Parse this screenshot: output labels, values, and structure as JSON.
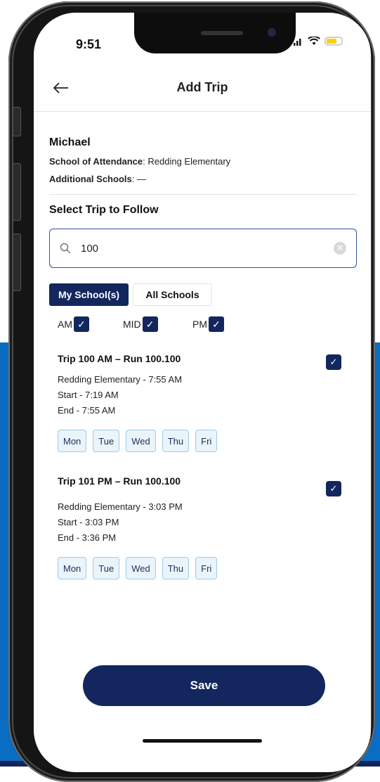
{
  "status_bar": {
    "time": "9:51"
  },
  "header": {
    "back_icon": "arrow-left-icon",
    "title": "Add Trip"
  },
  "student": {
    "name": "Michael",
    "school_label": "School of Attendance",
    "school_value": "Redding Elementary",
    "additional_label": "Additional Schools",
    "additional_value": "—"
  },
  "section_title": "Select Trip to Follow",
  "search": {
    "value": "100",
    "icon": "search-icon",
    "clear_icon": "clear-icon"
  },
  "segments": [
    {
      "label": "My School(s)",
      "active": true
    },
    {
      "label": "All Schools",
      "active": false
    }
  ],
  "filters": [
    {
      "label": "AM",
      "checked": true
    },
    {
      "label": "MID",
      "checked": true
    },
    {
      "label": "PM",
      "checked": true
    }
  ],
  "trips": [
    {
      "title": "Trip 100 AM – Run 100.100",
      "school_time": "Redding Elementary - 7:55 AM",
      "start": "Start - 7:19 AM",
      "end": "End - 7:55 AM",
      "selected": true,
      "days": [
        "Mon",
        "Tue",
        "Wed",
        "Thu",
        "Fri"
      ]
    },
    {
      "title": "Trip 101 PM – Run 100.100",
      "school_time": "Redding Elementary - 3:03 PM",
      "start": "Start - 3:03 PM",
      "end": "End - 3:36 PM",
      "selected": true,
      "days": [
        "Mon",
        "Tue",
        "Wed",
        "Thu",
        "Fri"
      ]
    }
  ],
  "save_label": "Save",
  "colors": {
    "primary": "#13275e",
    "accent": "#2e4fa0",
    "day_chip": "#e9f4fb",
    "background_blue": "#0a6cc2"
  }
}
